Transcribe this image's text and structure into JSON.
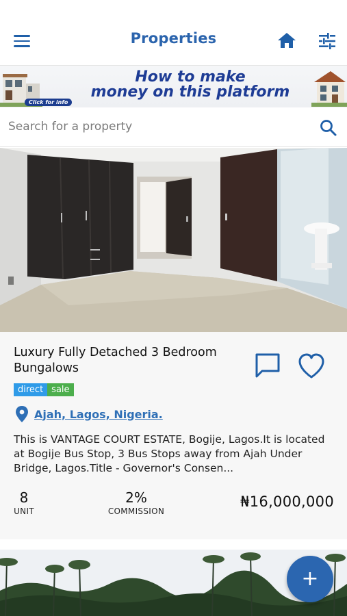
{
  "appbar": {
    "title": "Properties",
    "icons": {
      "menu": "hamburger-menu-icon",
      "home": "home-icon",
      "filter": "tune-icon"
    },
    "accent": "#2b64ad"
  },
  "banner": {
    "line1": "How to make",
    "line2": "money on this platform",
    "click_label": "Click for info"
  },
  "search": {
    "placeholder": "Search for a property",
    "value": "",
    "icon": "search-icon"
  },
  "listing": {
    "title": "Luxury Fully Detached 3 Bedroom Bungalows",
    "tags": {
      "direct": "direct",
      "sale": "sale"
    },
    "location": "Ajah, Lagos, Nigeria.",
    "description": "This is VANTAGE COURT ESTATE, Bogije, Lagos.It is located at Bogije Bus Stop, 3 Bus Stops away from Ajah Under Bridge, Lagos.Title - Governor's Consen...",
    "unit_value": "8",
    "unit_label": "UNIT",
    "commission_value": "2%",
    "commission_label": "COMMISSION",
    "price": "₦16,000,000",
    "colors": {
      "direct_tag": "#2f9be8",
      "sale_tag": "#4cae4c",
      "link": "#2e6fb6"
    }
  },
  "fab": {
    "label": "+",
    "icon": "add-icon",
    "color": "#2b66b0"
  }
}
